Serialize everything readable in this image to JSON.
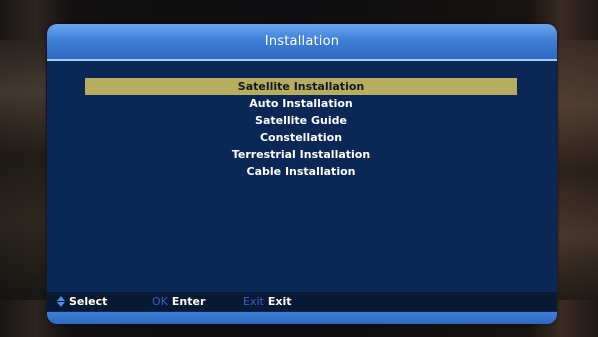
{
  "header": {
    "title": "Installation"
  },
  "menu": {
    "items": [
      {
        "label": "Satellite Installation",
        "selected": true
      },
      {
        "label": "Auto Installation",
        "selected": false
      },
      {
        "label": "Satellite Guide",
        "selected": false
      },
      {
        "label": "Constellation",
        "selected": false
      },
      {
        "label": "Terrestrial Installation",
        "selected": false
      },
      {
        "label": "Cable Installation",
        "selected": false
      }
    ]
  },
  "footer": {
    "select": {
      "icon": "up-down-arrows-icon",
      "label": "Select"
    },
    "ok": {
      "key": "OK",
      "label": "Enter"
    },
    "exit": {
      "key": "Exit",
      "label": "Exit"
    }
  },
  "colors": {
    "header": "#3f80d8",
    "panel": "#0b2755",
    "highlight": "#b6ae5e",
    "arrow": "#4a8cf0",
    "ok_key": "#2f62c8",
    "exit_key": "#3a5fd0"
  }
}
